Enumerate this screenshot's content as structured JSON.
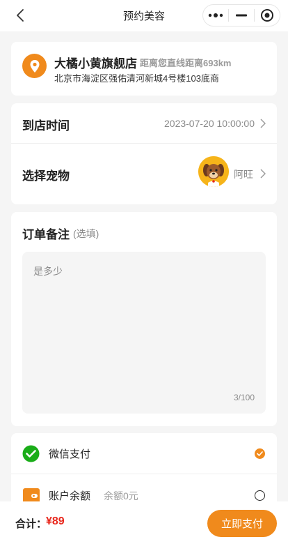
{
  "nav": {
    "title": "预约美容",
    "icons": [
      "back-chevron-icon",
      "more-dots-icon",
      "minimize-icon",
      "close-target-icon"
    ]
  },
  "store": {
    "name": "大橘小黄旗舰店",
    "distance": "距离您直线距离693km",
    "address": "北京市海淀区强佑清河新城4号楼103底商",
    "icon": "location-pin-icon"
  },
  "appointment": {
    "time_label": "到店时间",
    "time_value": "2023-07-20 10:00:00",
    "pet_label": "选择宠物",
    "pet_name": "阿旺"
  },
  "remark": {
    "title": "订单备注",
    "optional": "(选填)",
    "text": "是多少",
    "count": "3/100"
  },
  "payment": {
    "options": [
      {
        "label": "微信支付",
        "note": "",
        "icon": "wechat-pay-icon",
        "selected": true
      },
      {
        "label": "账户余额",
        "note": "余额0元",
        "icon": "wallet-icon",
        "selected": false
      }
    ]
  },
  "footer": {
    "total_label": "合计：",
    "total_amount": "¥89",
    "pay_button": "立即支付"
  },
  "colors": {
    "accent": "#f08a1c",
    "price": "#e8261b",
    "wechat": "#1aad19"
  }
}
